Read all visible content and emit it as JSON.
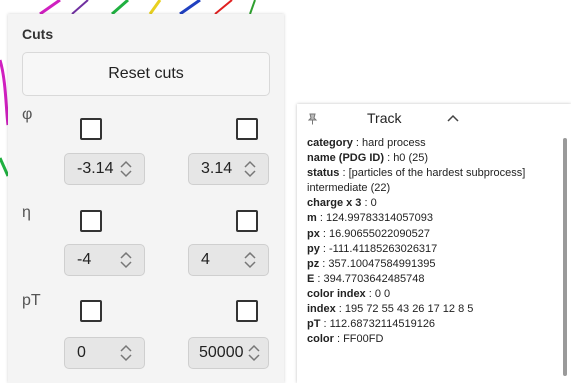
{
  "cuts": {
    "title": "Cuts",
    "reset_label": "Reset cuts",
    "rows": [
      {
        "symbol": "φ",
        "min_value": "-3.14",
        "max_value": "3.14"
      },
      {
        "symbol": "η",
        "min_value": "-4",
        "max_value": "4"
      },
      {
        "symbol": "pT",
        "min_value": "0",
        "max_value": "50000"
      }
    ]
  },
  "track": {
    "title": "Track",
    "icons": {
      "pin": "pin-icon",
      "collapse": "chevron-up-icon"
    },
    "properties": [
      {
        "key": "category",
        "value": "hard process"
      },
      {
        "key": "name (PDG ID)",
        "value": "h0 (25)"
      },
      {
        "key": "status",
        "value": "[particles of the hardest subprocess] intermediate (22)"
      },
      {
        "key": "charge x 3",
        "value": "0"
      },
      {
        "key": "m",
        "value": "124.99783314057093"
      },
      {
        "key": "px",
        "value": "16.90655022090527"
      },
      {
        "key": "py",
        "value": "-111.41185263026317"
      },
      {
        "key": "pz",
        "value": "357.10047584991395"
      },
      {
        "key": "E",
        "value": "394.7703642485748"
      },
      {
        "key": "color index",
        "value": "0 0"
      },
      {
        "key": "index",
        "value": "195 72 55 43 26 17 12 8 5"
      },
      {
        "key": "pT",
        "value": "112.68732114519126"
      },
      {
        "key": "color",
        "value": "FF00FD"
      }
    ]
  },
  "colors": {
    "track_color": "#FF00FD",
    "panel_bg": "#f4f4f4"
  }
}
